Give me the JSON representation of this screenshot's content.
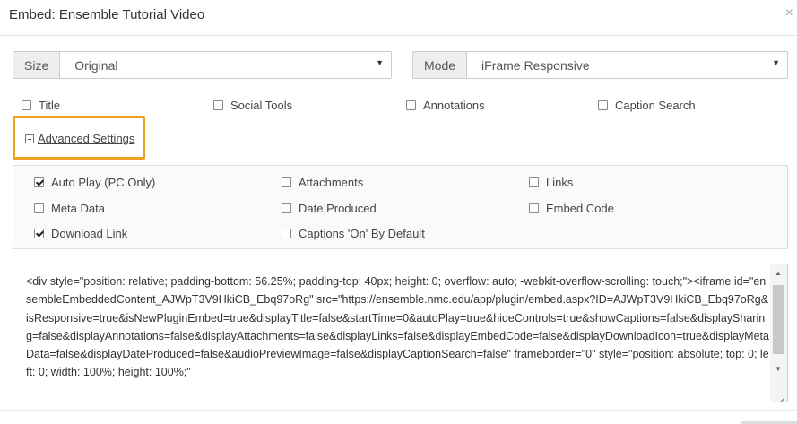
{
  "dialog": {
    "title": "Embed: Ensemble Tutorial Video",
    "close_glyph": "×"
  },
  "size": {
    "label": "Size",
    "value": "Original"
  },
  "mode": {
    "label": "Mode",
    "value": "iFrame Responsive"
  },
  "display_options": [
    {
      "label": "Title",
      "checked": false
    },
    {
      "label": "Social Tools",
      "checked": false
    },
    {
      "label": "Annotations",
      "checked": false
    },
    {
      "label": "Caption Search",
      "checked": false
    }
  ],
  "advanced": {
    "toggle_label": "Advanced Settings",
    "options": [
      {
        "label": "Auto Play (PC Only)",
        "checked": true
      },
      {
        "label": "Attachments",
        "checked": false
      },
      {
        "label": "Links",
        "checked": false
      },
      {
        "label": "Meta Data",
        "checked": false
      },
      {
        "label": "Date Produced",
        "checked": false
      },
      {
        "label": "Embed Code",
        "checked": false
      },
      {
        "label": "Download Link",
        "checked": true
      },
      {
        "label": "Captions 'On' By Default",
        "checked": false
      }
    ]
  },
  "embed_code": "<div style=\"position: relative; padding-bottom: 56.25%; padding-top: 40px; height: 0; overflow: auto; -webkit-overflow-scrolling: touch;\"><iframe id=\"ensembleEmbeddedContent_AJWpT3V9HkiCB_Ebq97oRg\" src=\"https://ensemble.nmc.edu/app/plugin/embed.aspx?ID=AJWpT3V9HkiCB_Ebq97oRg&isResponsive=true&isNewPluginEmbed=true&displayTitle=false&startTime=0&autoPlay=true&hideControls=true&showCaptions=false&displaySharing=false&displayAnnotations=false&displayAttachments=false&displayLinks=false&displayEmbedCode=false&displayDownloadIcon=true&displayMetaData=false&displayDateProduced=false&audioPreviewImage=false&displayCaptionSearch=false\" frameborder=\"0\" style=\"position: absolute; top: 0; left: 0; width: 100%; height: 100%;\"",
  "icons": {
    "caret": "▼",
    "scroll_up": "▲",
    "scroll_down": "▼"
  }
}
